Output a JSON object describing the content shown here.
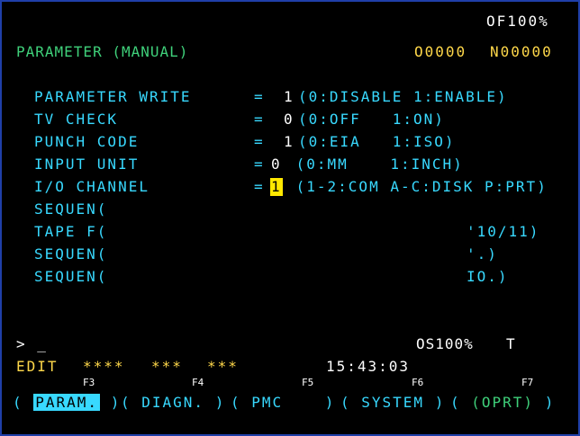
{
  "header": {
    "override": "OF100%",
    "title": "PARAMETER (MANUAL)",
    "program": "O0000",
    "sequence": "N00000"
  },
  "params": [
    {
      "name": "PARAMETER WRITE",
      "eq": "=",
      "value": "1",
      "desc": "(0:DISABLE 1:ENABLE)"
    },
    {
      "name": "TV CHECK",
      "eq": "=",
      "value": "0",
      "desc": "(0:OFF   1:ON)"
    },
    {
      "name": "PUNCH CODE",
      "eq": "=",
      "value": "1",
      "desc": "(0:EIA   1:ISO)"
    },
    {
      "name": "INPUT UNIT",
      "eq": "=",
      "value": "0",
      "desc": " (0:MM    1:INCH)"
    },
    {
      "name": "I/O CHANNEL",
      "eq": "=",
      "value": "1",
      "desc": " (1-2:COM A-C:DISK P:PRT)"
    },
    {
      "name": "SEQUEN(",
      "eq": "",
      "value": "",
      "desc": ""
    },
    {
      "name": "TAPE F(",
      "eq": "",
      "value": "",
      "desc": "'10/11)"
    },
    {
      "name": "SEQUEN(",
      "eq": "",
      "value": "",
      "desc": "'.)"
    },
    {
      "name": "SEQUEN(",
      "eq": "",
      "value": "",
      "desc": "IO.)"
    }
  ],
  "input_line": "> _",
  "status": {
    "feed_override": "OS100%",
    "t_label": "T",
    "mode": "EDIT",
    "stars1": "****",
    "stars2": "***",
    "stars3": "***",
    "time": "15:43:03"
  },
  "fkeys": [
    "F3",
    "F4",
    "F5",
    "F6",
    "F7"
  ],
  "softkeys": [
    "PARAM.",
    "DIAGN.",
    "PMC",
    "SYSTEM",
    "(OPRT)"
  ]
}
